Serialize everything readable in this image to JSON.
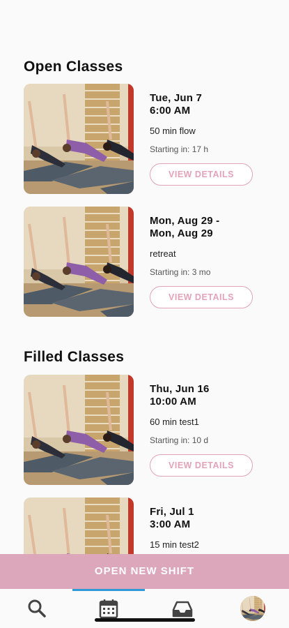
{
  "open_section": {
    "title": "Open Classes"
  },
  "filled_section": {
    "title": "Filled Classes"
  },
  "open_classes": [
    {
      "date_line1": "Tue, Jun 7",
      "date_line2": "6:00 AM",
      "description": "50 min flow",
      "starting": "Starting in: 17 h",
      "button": "VIEW DETAILS"
    },
    {
      "date_line1": "Mon, Aug 29 -",
      "date_line2": "Mon, Aug 29",
      "description": "retreat",
      "starting": "Starting in: 3 mo",
      "button": "VIEW DETAILS"
    }
  ],
  "filled_classes": [
    {
      "date_line1": "Thu, Jun 16",
      "date_line2": "10:00 AM",
      "description": "60 min test1",
      "starting": "Starting in: 10 d",
      "button": "VIEW DETAILS"
    },
    {
      "date_line1": "Fri, Jul 1",
      "date_line2": "3:00 AM",
      "description": "15 min test2"
    }
  ],
  "open_shift_button": "OPEN NEW SHIFT",
  "tabs": [
    {
      "icon": "search-icon"
    },
    {
      "icon": "calendar-icon",
      "active": true
    },
    {
      "icon": "inbox-icon"
    },
    {
      "icon": "profile-avatar"
    }
  ],
  "colors": {
    "accent_pink": "#dca6bb",
    "button_border": "#e2a3b8",
    "tab_indicator": "#2f9bd6"
  }
}
